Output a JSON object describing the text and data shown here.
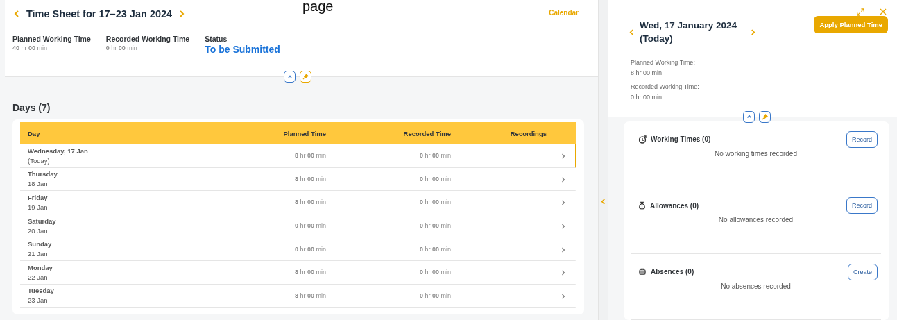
{
  "page_fragment": "page",
  "timesheet": {
    "title": "Time Sheet for 17–23 Jan 2024",
    "calendar_link": "Calendar",
    "summary": [
      {
        "label": "Planned Working Time",
        "value": "**40** hr  **00** min",
        "kind": "time"
      },
      {
        "label": "Recorded Working Time",
        "value": "**0** hr  **00** min",
        "kind": "time"
      },
      {
        "label": "Status",
        "value": "To be Submitted",
        "kind": "status"
      }
    ]
  },
  "days": {
    "title": "Days (7)",
    "columns": [
      "Day",
      "Planned Time",
      "Recorded Time",
      "Recordings"
    ],
    "rows": [
      {
        "day": "Wednesday, 17 Jan",
        "date": "(Today)",
        "planned": "**8** hr  **00** min",
        "recorded": "**0** hr  **00** min",
        "selected": true
      },
      {
        "day": "Thursday",
        "date": "18 Jan",
        "planned": "**8** hr  **00** min",
        "recorded": "**0** hr  **00** min",
        "selected": false
      },
      {
        "day": "Friday",
        "date": "19 Jan",
        "planned": "**8** hr  **00** min",
        "recorded": "**0** hr  **00** min",
        "selected": false
      },
      {
        "day": "Saturday",
        "date": "20 Jan",
        "planned": "**0** hr  **00** min",
        "recorded": "**0** hr  **00** min",
        "selected": false
      },
      {
        "day": "Sunday",
        "date": "21 Jan",
        "planned": "**0** hr  **00** min",
        "recorded": "**0** hr  **00** min",
        "selected": false
      },
      {
        "day": "Monday",
        "date": "22 Jan",
        "planned": "**8** hr  **00** min",
        "recorded": "**0** hr  **00** min",
        "selected": false
      },
      {
        "day": "Tuesday",
        "date": "23 Jan",
        "planned": "**8** hr  **00** min",
        "recorded": "**0** hr  **00** min",
        "selected": false
      }
    ]
  },
  "detail": {
    "title": "Wed, 17 January 2024 (Today)",
    "apply_button": "Apply Planned Time",
    "info": [
      {
        "label": "Planned Working Time:",
        "value": "8 hr 00 min"
      },
      {
        "label": "Recorded Working Time:",
        "value": "0 hr 00 min"
      }
    ],
    "sections": [
      {
        "kind": "working",
        "title": "Working Times (0)",
        "button": "Record",
        "empty": "No working times recorded"
      },
      {
        "kind": "allowance",
        "title": "Allowances (0)",
        "button": "Record",
        "empty": "No allowances recorded"
      },
      {
        "kind": "absence",
        "title": "Absences (0)",
        "button": "Create",
        "empty": "No absences recorded"
      }
    ]
  }
}
